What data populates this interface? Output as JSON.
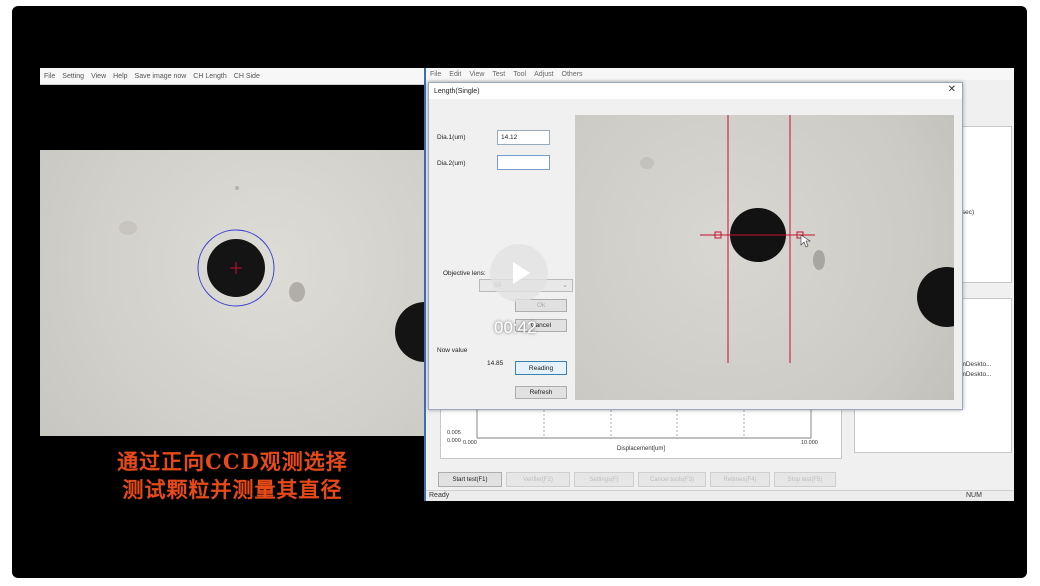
{
  "left_app": {
    "menu": [
      "File",
      "Setting",
      "View",
      "Help",
      "Save image now",
      "CH Length",
      "CH Side"
    ],
    "caption_line1": "通过正向CCD观测选择",
    "caption_line2": "测试颗粒并测量其直径"
  },
  "right_app": {
    "menu": [
      "File",
      "Edit",
      "View",
      "Test",
      "Tool",
      "Adjust",
      "Others"
    ],
    "side_text_1": "ilsec)",
    "side_text_2": "imDeskto...",
    "side_text_3": "imDeskto...",
    "chart": {
      "y_tick_top": "0.005",
      "y_tick_bottom": "0.000",
      "x_tick_left": "0.000",
      "x_tick_right": "10.000",
      "xlabel": "Displacement[um]"
    },
    "toolbar": {
      "start_test": "Start test(F1)",
      "btn2": "Verifier(F2)",
      "btn3": "Settings(F)",
      "btn4": "Cancel tools(F3)",
      "btn5": "Retimes(F4)",
      "btn6": "Stop test(F5)"
    },
    "status": {
      "left": "Ready",
      "right": "NUM"
    }
  },
  "dialog": {
    "title": "Length(Single)",
    "close_glyph": "✕",
    "dia1_label": "Dia.1(um)",
    "dia1_value": "14.12",
    "dia2_label": "Dia.2(um)",
    "dia2_value": "",
    "objective_label": "Objective lens:",
    "objective_value": "50",
    "ok_label": "Ok",
    "cancel_label": "Cancel",
    "now_value_label": "Now value",
    "now_value": "14.85",
    "reading_label": "Reading",
    "refresh_label": "Refresh"
  },
  "player": {
    "time": "00:42"
  },
  "colors": {
    "caption": "#e64a19",
    "crosshair": "#c8102e",
    "circle": "#3b3fd6",
    "accent_border": "#3a6fb5"
  },
  "icons": [
    "play-icon",
    "close-icon",
    "chevron-down-icon",
    "cursor-icon"
  ]
}
